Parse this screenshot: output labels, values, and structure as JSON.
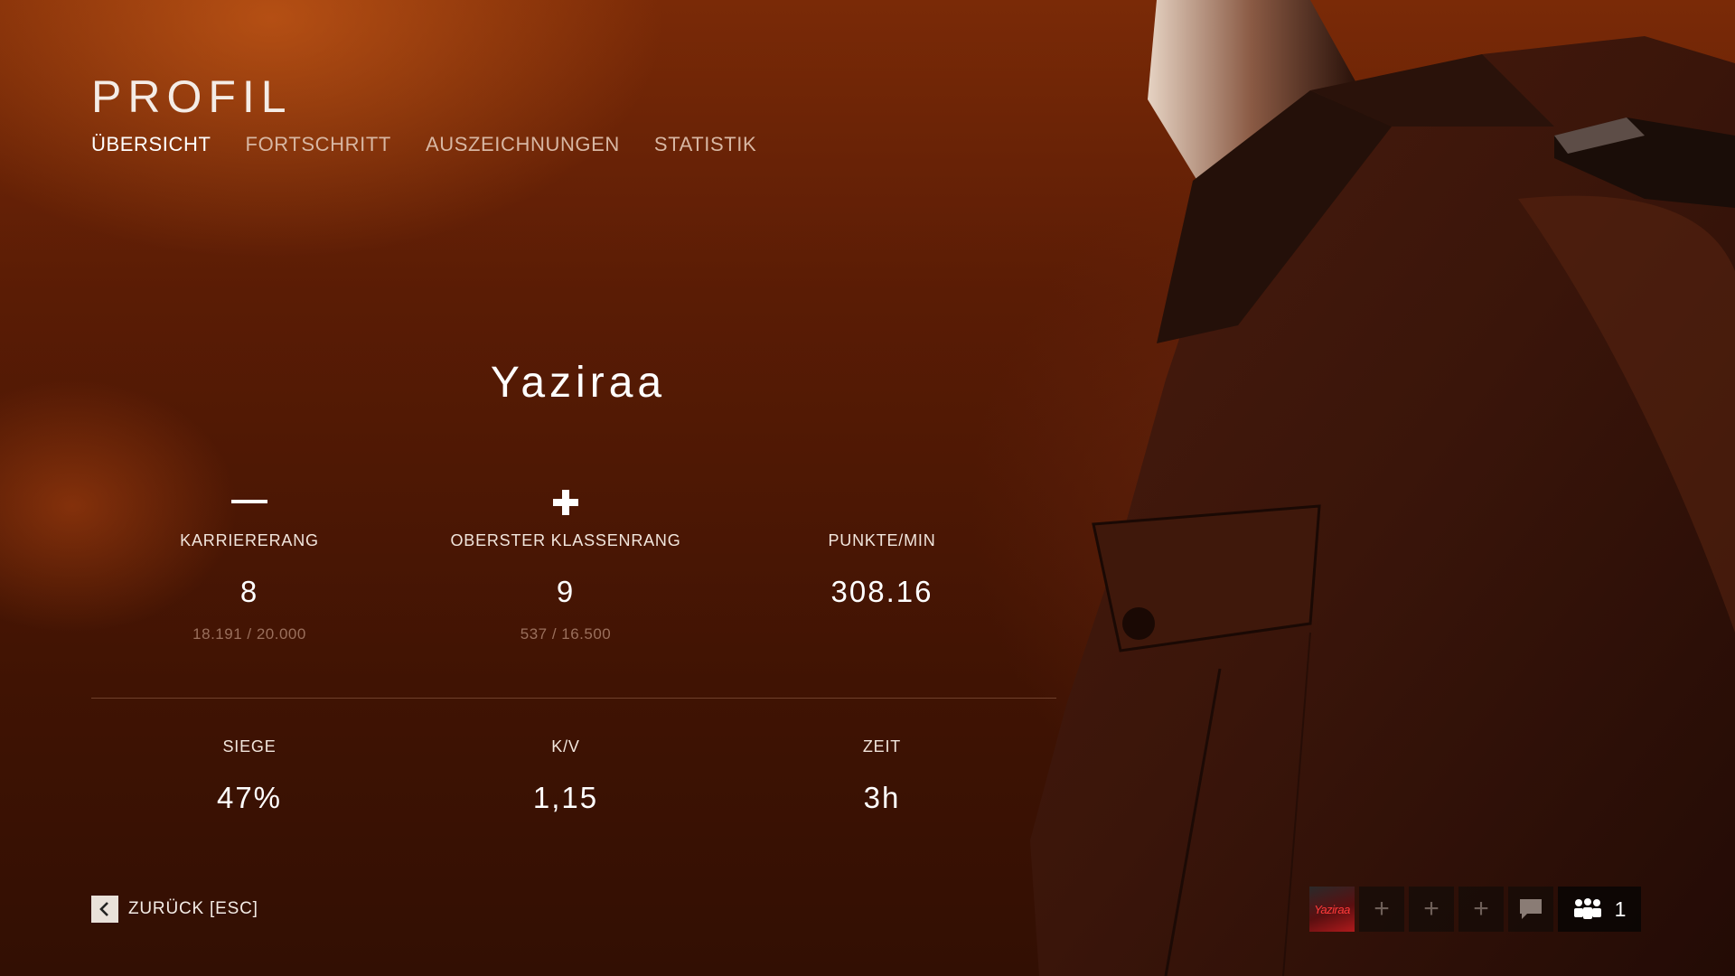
{
  "header": {
    "title": "PROFIL",
    "tabs": [
      {
        "label": "ÜBERSICHT",
        "active": true
      },
      {
        "label": "FORTSCHRITT",
        "active": false
      },
      {
        "label": "AUSZEICHNUNGEN",
        "active": false
      },
      {
        "label": "STATISTIK",
        "active": false
      }
    ]
  },
  "profile": {
    "username": "Yaziraa",
    "stats_top": [
      {
        "label": "KARRIERERANG",
        "value": "8",
        "sub": "18.191 / 20.000",
        "icon": "rank-bar-icon"
      },
      {
        "label": "OBERSTER KLASSENRANG",
        "value": "9",
        "sub": "537 / 16.500",
        "icon": "medic-cross-icon"
      },
      {
        "label": "PUNKTE/MIN",
        "value": "308.16",
        "sub": ""
      }
    ],
    "stats_bottom": [
      {
        "label": "SIEGE",
        "value": "47%"
      },
      {
        "label": "K/V",
        "value": "1,15"
      },
      {
        "label": "ZEIT",
        "value": "3h"
      }
    ]
  },
  "footer": {
    "back_label": "ZURÜCK [ESC]",
    "squad": {
      "avatar_text": "Yaziraa",
      "party_count": "1"
    }
  },
  "colors": {
    "accent_bg": "#5a1c05",
    "text": "#f3e8e0",
    "muted": "#9a6f5c"
  }
}
